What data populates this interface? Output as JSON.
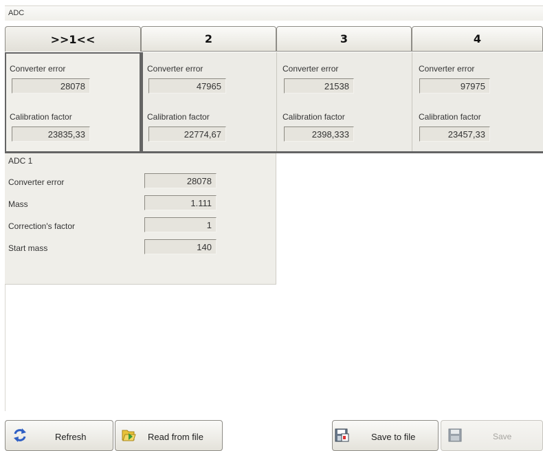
{
  "window": {
    "title": "ADC"
  },
  "tabs": [
    {
      "label": ">>1<<",
      "active": true
    },
    {
      "label": "2",
      "active": false
    },
    {
      "label": "3",
      "active": false
    },
    {
      "label": "4",
      "active": false
    }
  ],
  "channels": [
    {
      "converter_label": "Converter error",
      "converter_value": "28078",
      "calibration_label": "Calibration factor",
      "calibration_value": "23835,33"
    },
    {
      "converter_label": "Converter error",
      "converter_value": "47965",
      "calibration_label": "Calibration factor",
      "calibration_value": "22774,67"
    },
    {
      "converter_label": "Converter error",
      "converter_value": "21538",
      "calibration_label": "Calibration factor",
      "calibration_value": "2398,333"
    },
    {
      "converter_label": "Converter error",
      "converter_value": "97975",
      "calibration_label": "Calibration factor",
      "calibration_value": "23457,33"
    }
  ],
  "detail": {
    "title": "ADC 1",
    "rows": [
      {
        "label": "Converter error",
        "value": "28078"
      },
      {
        "label": "Mass",
        "value": "1.111"
      },
      {
        "label": "Correction's factor",
        "value": "1"
      },
      {
        "label": "Start mass",
        "value": "140"
      }
    ]
  },
  "buttons": {
    "refresh": {
      "label": "Refresh",
      "icon": "refresh-icon"
    },
    "read": {
      "label": "Read from file",
      "icon": "folder-open-icon"
    },
    "save_file": {
      "label": "Save to file",
      "icon": "save-file-icon"
    },
    "save": {
      "label": "Save",
      "icon": "floppy-disk-icon",
      "enabled": false
    }
  },
  "colors": {
    "panel_bg": "#ecebe6",
    "active_border": "#646464",
    "refresh_blue": "#2f5fc4",
    "folder_yellow": "#e8c23a",
    "folder_green": "#3a9a3a"
  }
}
